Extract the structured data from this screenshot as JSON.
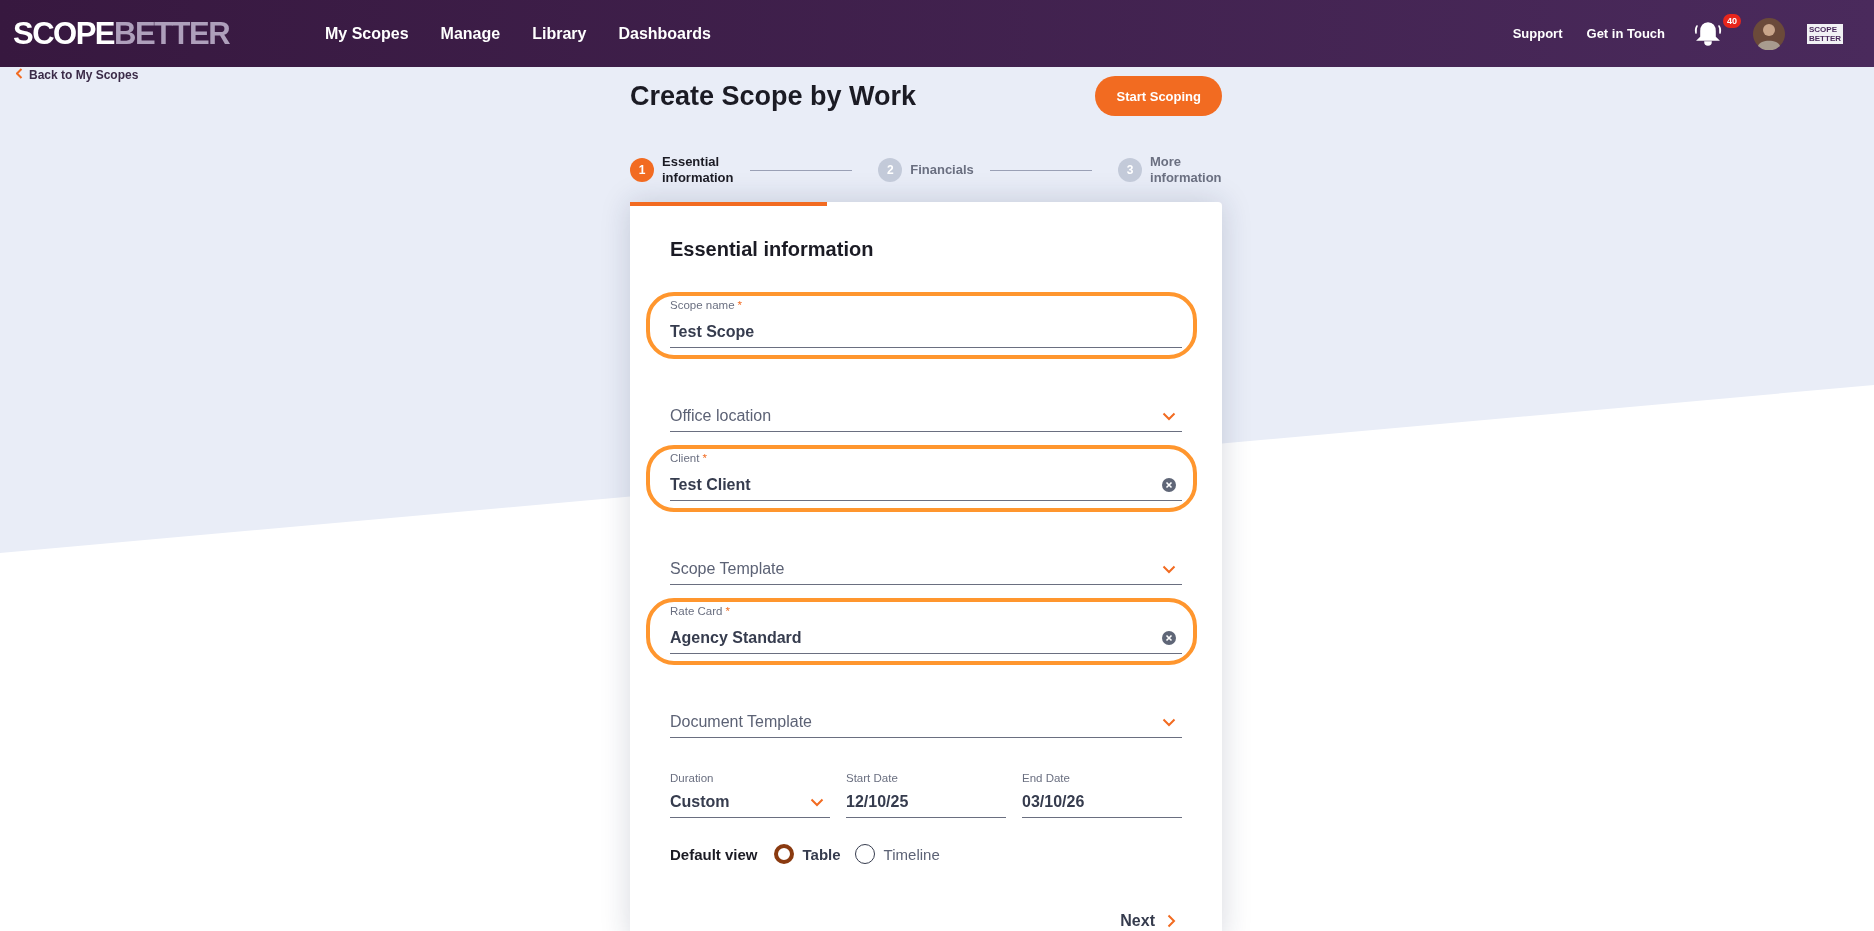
{
  "header": {
    "logo": {
      "part_1": "SCOPE",
      "part_2": "BETTER"
    },
    "nav": [
      "My Scopes",
      "Manage",
      "Library",
      "Dashboards"
    ],
    "links": [
      "Support",
      "Get in Touch"
    ],
    "notifications": {
      "badge": "40"
    },
    "account_logo": {
      "line_1": "SCOPE",
      "line_2": "BETTER"
    }
  },
  "back_link": "Back to My Scopes",
  "page_title": "Create Scope by Work",
  "primary_button": "Start Scoping",
  "steps": [
    {
      "number": "1",
      "label": "Essential information",
      "selected": true
    },
    {
      "number": "2",
      "label": "Financials",
      "selected": false
    },
    {
      "number": "3",
      "label": "More information",
      "selected": false
    }
  ],
  "form": {
    "title": "Essential information",
    "fields": [
      {
        "kind": "text",
        "label": "Scope name",
        "required_mark": "*",
        "value": "Test Scope",
        "highlighted": true
      },
      {
        "kind": "select",
        "placeholder": "Office location",
        "highlighted": false
      },
      {
        "kind": "clearable",
        "label": "Client",
        "required_mark": "*",
        "value": "Test Client",
        "highlighted": true
      },
      {
        "kind": "select",
        "placeholder": "Scope Template",
        "highlighted": false
      },
      {
        "kind": "clearable",
        "label": "Rate Card",
        "required_mark": "*",
        "value": "Agency Standard",
        "highlighted": true
      },
      {
        "kind": "select",
        "placeholder": "Document Template",
        "highlighted": false
      }
    ],
    "date_row": [
      {
        "kind": "select",
        "label": "Duration",
        "value": "Custom"
      },
      {
        "kind": "text",
        "label": "Start Date",
        "value": "12/10/25"
      },
      {
        "kind": "text",
        "label": "End Date",
        "value": "03/10/26"
      }
    ],
    "default_view": {
      "label": "Default view",
      "options": [
        {
          "label": "Table",
          "selected": true
        },
        {
          "label": "Timeline",
          "selected": false
        }
      ]
    },
    "next_button": "Next"
  }
}
